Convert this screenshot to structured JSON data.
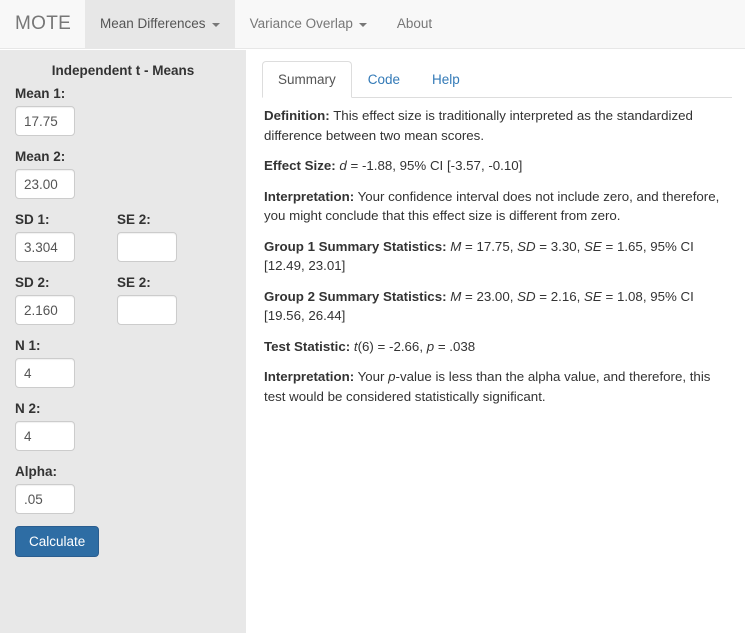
{
  "navbar": {
    "brand": "MOTE",
    "items": [
      {
        "label": "Mean Differences",
        "caret": true,
        "active": true
      },
      {
        "label": "Variance Overlap",
        "caret": true,
        "active": false
      },
      {
        "label": "About",
        "caret": false,
        "active": false
      }
    ]
  },
  "sidebar": {
    "title": "Independent t - Means",
    "fields": [
      {
        "label": "Mean 1:",
        "value": "17.75"
      },
      {
        "label": "Mean 2:",
        "value": "23.00"
      },
      {
        "label": "SD 1:",
        "value": "3.304"
      },
      {
        "label": "SE 2:",
        "value": ""
      },
      {
        "label": "SD 2:",
        "value": "2.160"
      },
      {
        "label": "SE 2:",
        "value": ""
      },
      {
        "label": "N 1:",
        "value": "4"
      },
      {
        "label": "N 2:",
        "value": "4"
      },
      {
        "label": "Alpha:",
        "value": ".05"
      }
    ],
    "calculate_label": "Calculate"
  },
  "main": {
    "tabs": [
      {
        "label": "Summary",
        "active": true
      },
      {
        "label": "Code",
        "active": false
      },
      {
        "label": "Help",
        "active": false
      }
    ],
    "summary": {
      "definition_label": "Definition:",
      "definition_text": " This effect size is traditionally interpreted as the standardized difference between two mean scores.",
      "effect_size_label": "Effect Size:",
      "effect_size_d": "d",
      "effect_size_text": " = -1.88, 95% CI [-3.57, -0.10]",
      "interpretation1_label": "Interpretation:",
      "interpretation1_text": " Your confidence interval does not include zero, and therefore, you might conclude that this effect size is different from zero.",
      "group1_label": "Group 1 Summary Statistics:",
      "group1_m_sym": "M",
      "group1_m_val": " = 17.75, ",
      "group1_sd_sym": "SD",
      "group1_sd_val": " = 3.30, ",
      "group1_se_sym": "SE",
      "group1_se_val": " = 1.65, 95% CI [12.49, 23.01]",
      "group2_label": "Group 2 Summary Statistics:",
      "group2_m_sym": "M",
      "group2_m_val": " = 23.00, ",
      "group2_sd_sym": "SD",
      "group2_sd_val": " = 2.16, ",
      "group2_se_sym": "SE",
      "group2_se_val": " = 1.08, 95% CI [19.56, 26.44]",
      "test_stat_label": "Test Statistic:",
      "test_stat_t_sym": "t",
      "test_stat_t_val": "(6) = -2.66, ",
      "test_stat_p_sym": "p",
      "test_stat_p_val": " = .038",
      "interpretation2_label": "Interpretation:",
      "interpretation2_text_a": " Your ",
      "interpretation2_p_sym": "p",
      "interpretation2_text_b": "-value is less than the alpha value, and therefore, this test would be considered statistically significant."
    }
  },
  "colors": {
    "navbar_bg": "#f8f8f8",
    "nav_active_bg": "#e7e7e7",
    "sidebar_bg": "#e8e8e8",
    "primary_button": "#2e6da4",
    "link": "#337ab7",
    "text": "#333333"
  }
}
